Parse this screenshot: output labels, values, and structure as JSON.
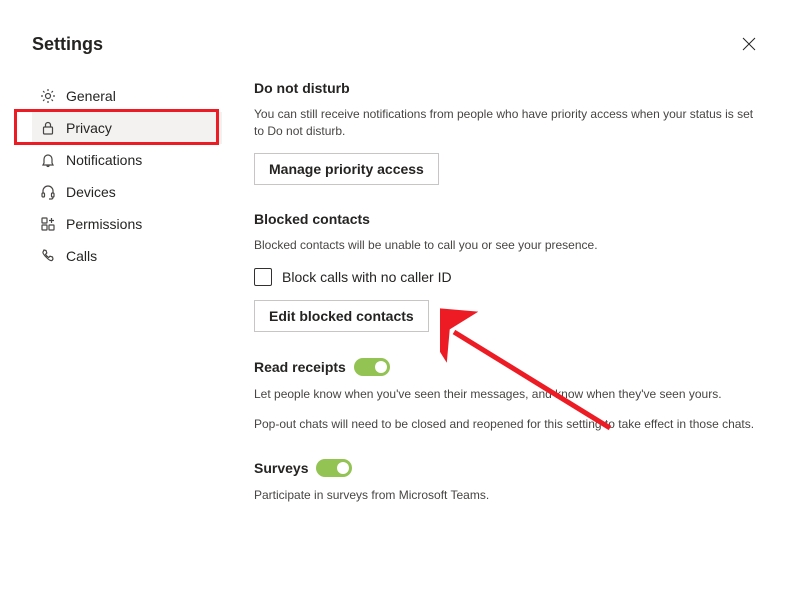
{
  "title": "Settings",
  "sidebar": {
    "items": [
      {
        "label": "General"
      },
      {
        "label": "Privacy"
      },
      {
        "label": "Notifications"
      },
      {
        "label": "Devices"
      },
      {
        "label": "Permissions"
      },
      {
        "label": "Calls"
      }
    ]
  },
  "sections": {
    "dnd": {
      "title": "Do not disturb",
      "desc": "You can still receive notifications from people who have priority access when your status is set to Do not disturb.",
      "button": "Manage priority access"
    },
    "blocked": {
      "title": "Blocked contacts",
      "desc": "Blocked contacts will be unable to call you or see your presence.",
      "checkbox": "Block calls with no caller ID",
      "button": "Edit blocked contacts"
    },
    "receipts": {
      "title": "Read receipts",
      "desc1": "Let people know when you've seen their messages, and know when they've seen yours.",
      "desc2": "Pop-out chats will need to be closed and reopened for this setting to take effect in those chats."
    },
    "surveys": {
      "title": "Surveys",
      "desc": "Participate in surveys from Microsoft Teams."
    }
  }
}
